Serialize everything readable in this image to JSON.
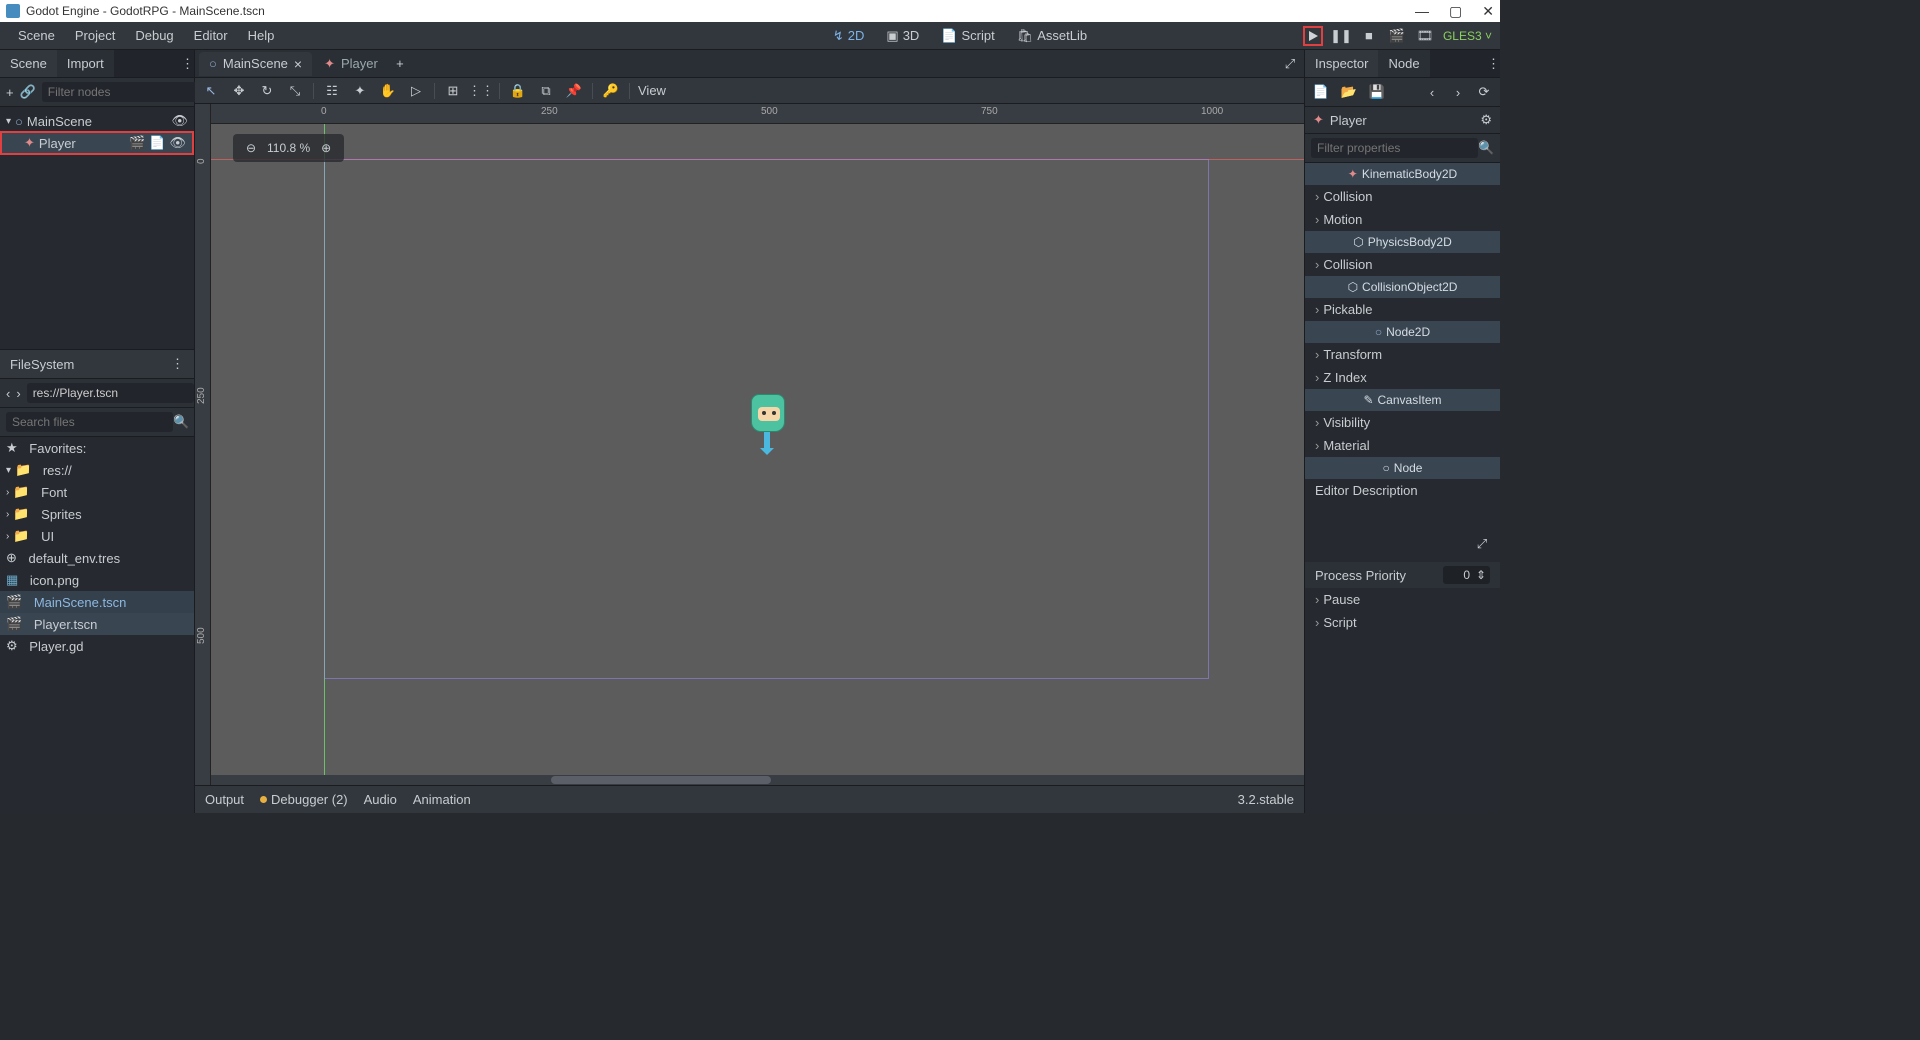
{
  "window": {
    "title": "Godot Engine - GodotRPG - MainScene.tscn"
  },
  "menu": {
    "scene": "Scene",
    "project": "Project",
    "debug": "Debug",
    "editor": "Editor",
    "help": "Help"
  },
  "workspace": {
    "t2d": "2D",
    "t3d": "3D",
    "script": "Script",
    "assetlib": "AssetLib"
  },
  "renderer": "GLES3",
  "scene_dock": {
    "tabs": {
      "scene": "Scene",
      "import": "Import"
    },
    "filter_placeholder": "Filter nodes",
    "root": "MainScene",
    "child": "Player"
  },
  "filesystem": {
    "title": "FileSystem",
    "path": "res://Player.tscn",
    "search_placeholder": "Search files",
    "favorites": "Favorites:",
    "root": "res://",
    "folders": [
      "Font",
      "Sprites",
      "UI"
    ],
    "files": [
      "default_env.tres",
      "icon.png",
      "MainScene.tscn",
      "Player.tscn",
      "Player.gd"
    ]
  },
  "open_scenes": {
    "main": "MainScene",
    "player": "Player"
  },
  "viewport": {
    "zoom": "110.8 %",
    "view_label": "View",
    "ruler_h": [
      "0",
      "250",
      "500",
      "750",
      "1000"
    ],
    "ruler_v": [
      "0",
      "250",
      "500"
    ]
  },
  "inspector": {
    "tabs": {
      "inspector": "Inspector",
      "node": "Node"
    },
    "selected": "Player",
    "filter_placeholder": "Filter properties",
    "classes": {
      "kinematic": "KinematicBody2D",
      "physics": "PhysicsBody2D",
      "collobj": "CollisionObject2D",
      "node2d": "Node2D",
      "canvas": "CanvasItem",
      "node": "Node"
    },
    "groups": {
      "collision": "Collision",
      "motion": "Motion",
      "collision2": "Collision",
      "pickable": "Pickable",
      "transform": "Transform",
      "zindex": "Z Index",
      "visibility": "Visibility",
      "material": "Material",
      "pause": "Pause",
      "script": "Script"
    },
    "editor_desc": "Editor Description",
    "process_priority": {
      "label": "Process Priority",
      "value": "0"
    }
  },
  "bottom": {
    "output": "Output",
    "debugger": "Debugger (2)",
    "audio": "Audio",
    "animation": "Animation",
    "version": "3.2.stable"
  }
}
